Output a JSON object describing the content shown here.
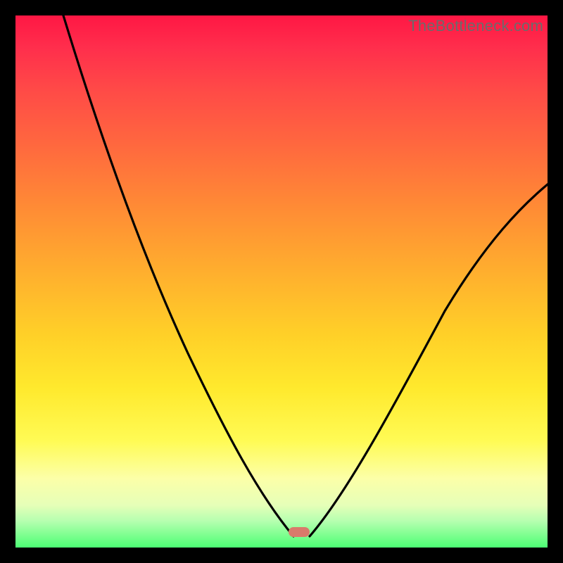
{
  "attribution": "TheBottleneck.com",
  "colors": {
    "frame": "#000000",
    "curve": "#000000",
    "tick": "#d97a6b",
    "gradient_top": "#ff1744",
    "gradient_bottom": "#4cff74"
  },
  "chart_data": {
    "type": "line",
    "title": "",
    "xlabel": "",
    "ylabel": "",
    "xlim": [
      0,
      100
    ],
    "ylim": [
      0,
      100
    ],
    "annotations": [
      {
        "text": "TheBottleneck.com",
        "pos": "top-right"
      }
    ],
    "series": [
      {
        "name": "left-branch",
        "x": [
          9,
          12,
          16,
          20,
          24,
          28,
          32,
          36,
          40,
          44,
          47,
          50,
          52
        ],
        "y": [
          100,
          92,
          82,
          72,
          63,
          54,
          45,
          36,
          27,
          18,
          10,
          4,
          1
        ]
      },
      {
        "name": "right-branch",
        "x": [
          55,
          58,
          62,
          66,
          70,
          74,
          78,
          82,
          86,
          90,
          94,
          98,
          100
        ],
        "y": [
          1,
          3,
          7,
          12,
          18,
          24,
          31,
          38,
          45,
          52,
          59,
          65,
          68
        ]
      }
    ],
    "marker": {
      "x": 53,
      "y": 2,
      "color": "#d97a6b"
    },
    "notes": "Values read off the shape of the V-curve relative to the plot box; y=0 at bottom (green), y=100 at top (red). Left branch starts at top-left edge ~x=9,y=100 and descends convexly to the trough near x≈52. Right branch rises concavely from the trough to ~x=100,y≈68."
  }
}
